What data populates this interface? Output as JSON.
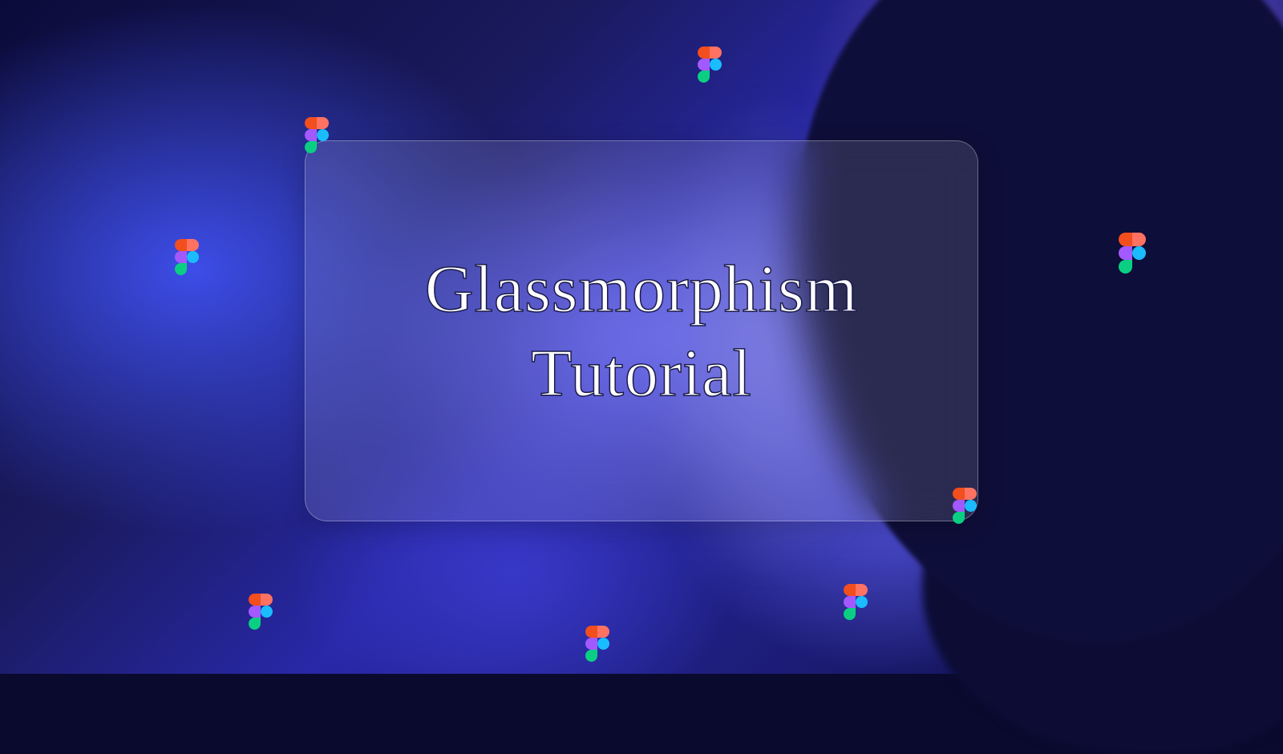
{
  "card": {
    "title_line1": "Glassmorphism",
    "title_line2": "Tutorial"
  },
  "colors": {
    "figma_red": "#F24E1E",
    "figma_orange": "#FF7262",
    "figma_purple": "#A259FF",
    "figma_blue": "#1ABCFE",
    "figma_green": "#0ACF83"
  }
}
